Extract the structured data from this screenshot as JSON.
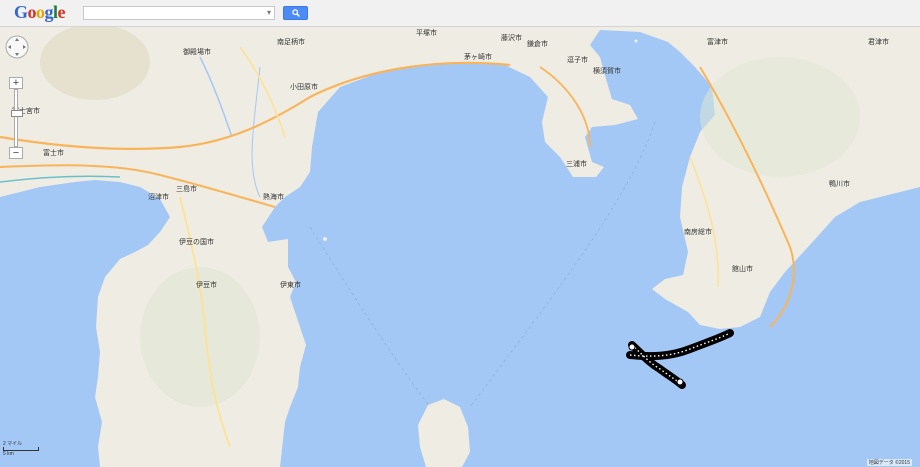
{
  "header": {
    "logo_letters": [
      "G",
      "o",
      "o",
      "g",
      "l",
      "e"
    ],
    "search_value": ""
  },
  "map": {
    "places": [
      {
        "name": "南足柄市",
        "type": "city"
      },
      {
        "name": "御殿場市",
        "type": "city"
      },
      {
        "name": "平塚市",
        "type": "city"
      },
      {
        "name": "茅ヶ崎市",
        "type": "city"
      },
      {
        "name": "藤沢市",
        "type": "city"
      },
      {
        "name": "鎌倉市",
        "type": "city"
      },
      {
        "name": "逗子市",
        "type": "city"
      },
      {
        "name": "横須賀市",
        "type": "city"
      },
      {
        "name": "三浦市",
        "type": "city"
      },
      {
        "name": "小田原市",
        "type": "city"
      },
      {
        "name": "富士宮市",
        "type": "city"
      },
      {
        "name": "富士市",
        "type": "city"
      },
      {
        "name": "三島市",
        "type": "city"
      },
      {
        "name": "沼津市",
        "type": "city"
      },
      {
        "name": "熱海市",
        "type": "city"
      },
      {
        "name": "伊豆の国市",
        "type": "city"
      },
      {
        "name": "伊豆市",
        "type": "city"
      },
      {
        "name": "伊東市",
        "type": "city"
      },
      {
        "name": "富津市",
        "type": "city"
      },
      {
        "name": "君津市",
        "type": "city"
      },
      {
        "name": "鴨川市",
        "type": "city"
      },
      {
        "name": "南房総市",
        "type": "city"
      },
      {
        "name": "館山市",
        "type": "city"
      }
    ],
    "scale": {
      "top": "2 マイル",
      "bottom": "5 km"
    },
    "attribution": "地図データ ©2015"
  }
}
